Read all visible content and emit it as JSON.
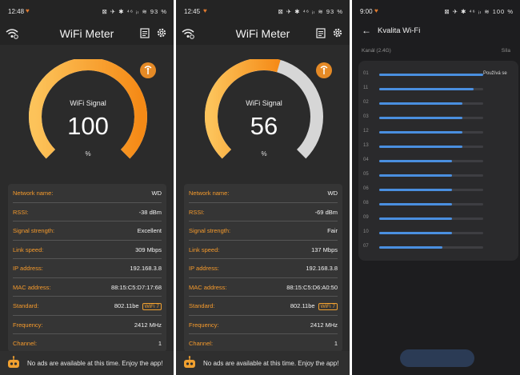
{
  "colors": {
    "accent": "#f59a2c",
    "gauge_track": "#d6d6d6",
    "bar": "#4a8fe0"
  },
  "panels": [
    {
      "status": {
        "time": "12:48",
        "icons": "⊠ ✈ ✱ ⁴⁶ ᵢₗ ≋",
        "battery": "93 %"
      },
      "app_title": "WiFi Meter",
      "gauge": {
        "label": "WiFi Signal",
        "value": "100",
        "unit": "%",
        "fraction": 1.0
      },
      "rows": [
        {
          "key": "Network name:",
          "value": "WD"
        },
        {
          "key": "RSSI:",
          "value": "-38 dBm"
        },
        {
          "key": "Signal strength:",
          "value": "Excellent"
        },
        {
          "key": "Link speed:",
          "value": "309 Mbps"
        },
        {
          "key": "IP address:",
          "value": "192.168.3.8"
        },
        {
          "key": "MAC address:",
          "value": "88:15:C5:D7:17:68"
        },
        {
          "key": "Standard:",
          "value": "802.11be",
          "badge": "WiFi 7"
        },
        {
          "key": "Frequency:",
          "value": "2412 MHz"
        },
        {
          "key": "Channel:",
          "value": "1"
        }
      ],
      "ad_text": "No ads are available at this time. Enjoy the app!"
    },
    {
      "status": {
        "time": "12:45",
        "icons": "⊠ ✈ ✱ ⁴⁶ ᵢₗ ≋",
        "battery": "93 %"
      },
      "app_title": "WiFi Meter",
      "gauge": {
        "label": "WiFi Signal",
        "value": "56",
        "unit": "%",
        "fraction": 0.56
      },
      "rows": [
        {
          "key": "Network name:",
          "value": "WD"
        },
        {
          "key": "RSSI:",
          "value": "-69 dBm"
        },
        {
          "key": "Signal strength:",
          "value": "Fair"
        },
        {
          "key": "Link speed:",
          "value": "137 Mbps"
        },
        {
          "key": "IP address:",
          "value": "192.168.3.8"
        },
        {
          "key": "MAC address:",
          "value": "88:15:C5:D6:A0:50"
        },
        {
          "key": "Standard:",
          "value": "802.11be",
          "badge": "WiFi 7"
        },
        {
          "key": "Frequency:",
          "value": "2412 MHz"
        },
        {
          "key": "Channel:",
          "value": "1"
        }
      ],
      "ad_text": "No ads are available at this time. Enjoy the app!"
    }
  ],
  "quality": {
    "status": {
      "time": "9:00",
      "icons": "⊠ ✈ ✱ ⁴⁶ ᵢₗ ≋",
      "battery": "100 %"
    },
    "title": "Kvalita Wi-Fi",
    "band_label": "Kanál (2.4G)",
    "strength_label": "Síla",
    "in_use_label": "Používá se",
    "channels": [
      {
        "num": "01",
        "level": 1.0,
        "in_use": true
      },
      {
        "num": "11",
        "level": 0.91
      },
      {
        "num": "02",
        "level": 0.8
      },
      {
        "num": "03",
        "level": 0.8
      },
      {
        "num": "12",
        "level": 0.8
      },
      {
        "num": "13",
        "level": 0.8
      },
      {
        "num": "04",
        "level": 0.7
      },
      {
        "num": "05",
        "level": 0.7
      },
      {
        "num": "06",
        "level": 0.7
      },
      {
        "num": "08",
        "level": 0.7
      },
      {
        "num": "09",
        "level": 0.7
      },
      {
        "num": "10",
        "level": 0.7
      },
      {
        "num": "07",
        "level": 0.61
      }
    ]
  }
}
